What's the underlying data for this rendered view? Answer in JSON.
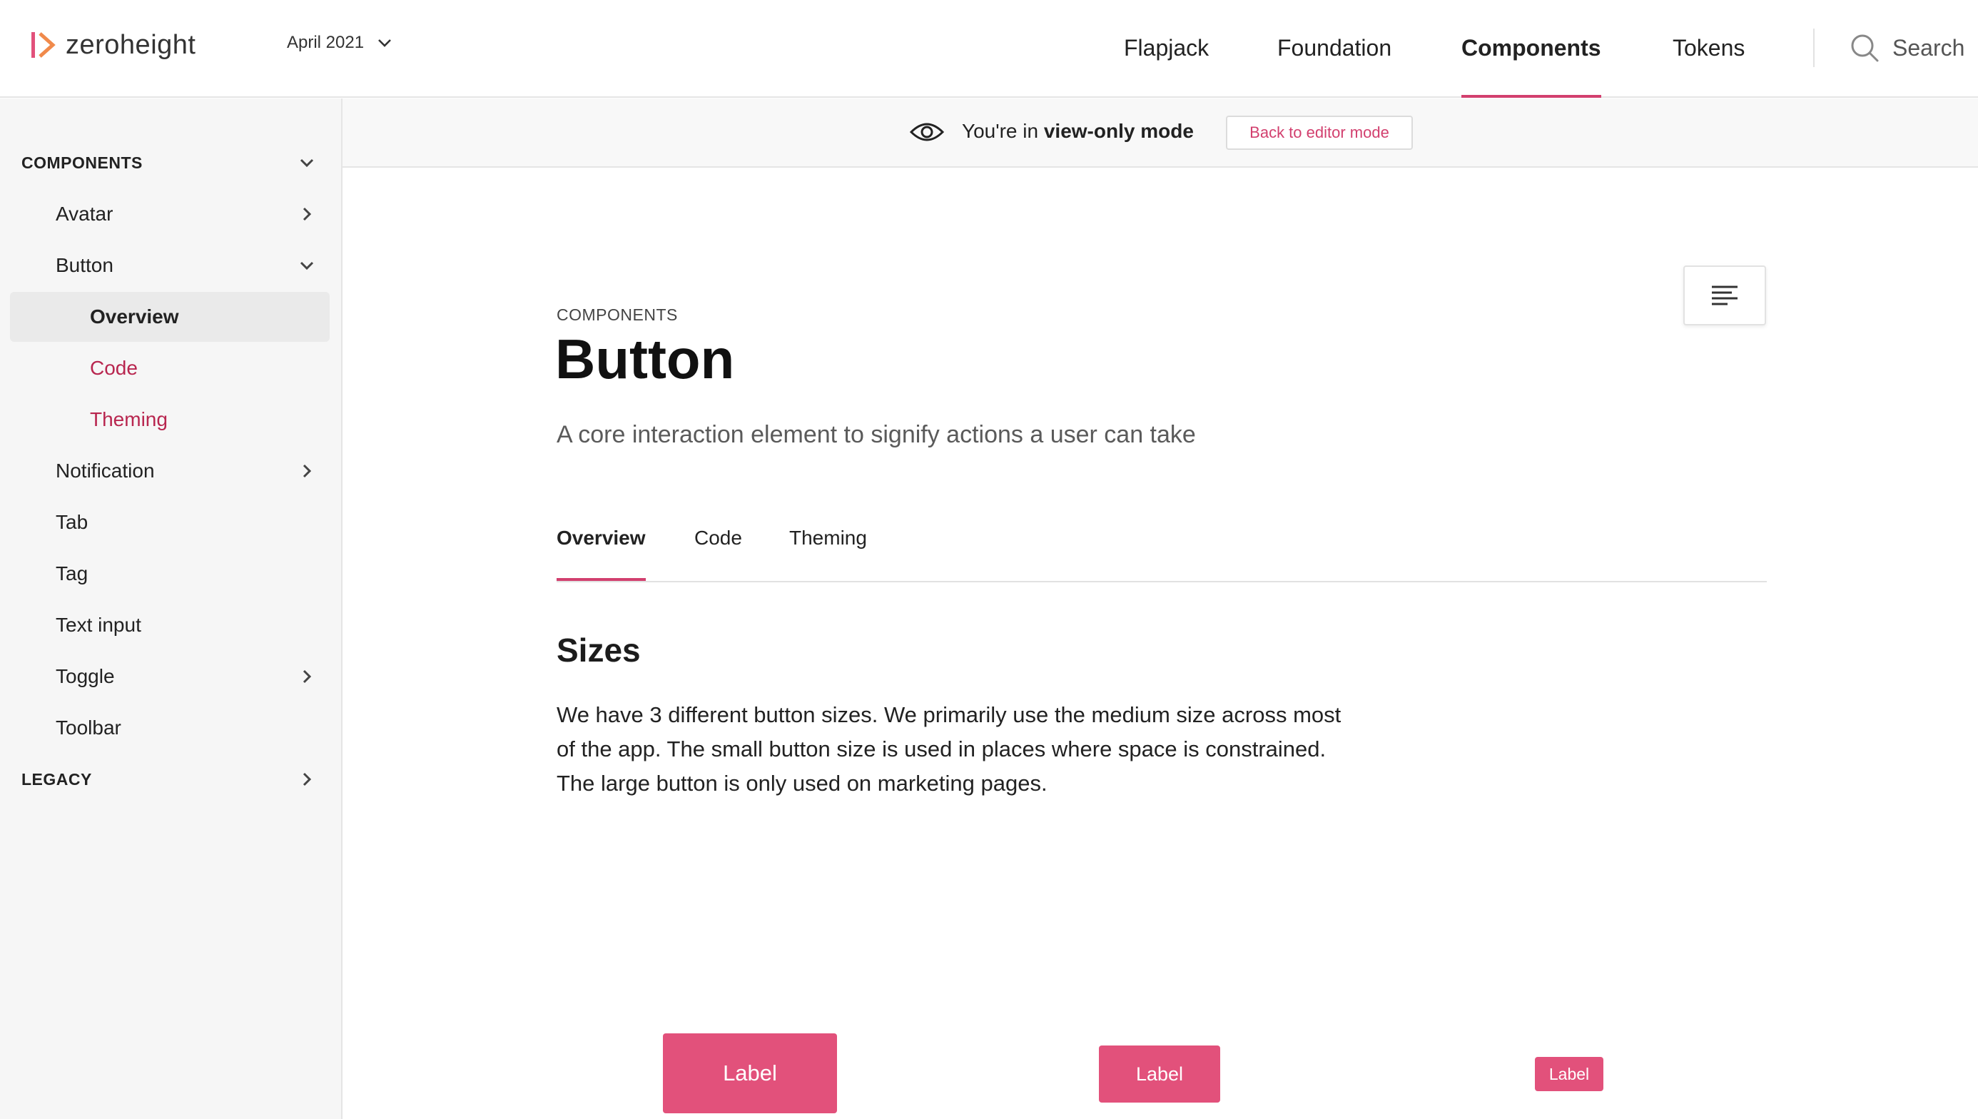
{
  "header": {
    "brand_name": "zeroheight",
    "version": "April 2021",
    "nav": [
      {
        "label": "Flapjack"
      },
      {
        "label": "Foundation"
      },
      {
        "label": "Components"
      },
      {
        "label": "Tokens"
      }
    ],
    "active_nav": "Components",
    "search_label": "Search"
  },
  "sidebar": {
    "items": [
      {
        "label": "COMPONENTS",
        "level": "section",
        "chevron": "chevron-down-icon"
      },
      {
        "label": "Avatar",
        "level": 1,
        "chevron": "chevron-right-icon"
      },
      {
        "label": "Button",
        "level": 1,
        "chevron": "chevron-down-icon"
      },
      {
        "label": "Overview",
        "level": 2,
        "selected": true
      },
      {
        "label": "Code",
        "level": 2
      },
      {
        "label": "Theming",
        "level": 2
      },
      {
        "label": "Notification",
        "level": 1,
        "chevron": "chevron-right-icon"
      },
      {
        "label": "Tab",
        "level": 1
      },
      {
        "label": "Tag",
        "level": 1
      },
      {
        "label": "Text input",
        "level": 1
      },
      {
        "label": "Toggle",
        "level": 1,
        "chevron": "chevron-right-icon"
      },
      {
        "label": "Toolbar",
        "level": 1
      },
      {
        "label": "LEGACY",
        "level": "section",
        "chevron": "chevron-right-icon"
      }
    ]
  },
  "banner": {
    "prefix": "You're in ",
    "mode": "view-only mode",
    "editor_button": "Back to editor mode"
  },
  "page": {
    "eyebrow": "COMPONENTS",
    "title": "Button",
    "subtitle": "A core interaction element to signify actions a user can take",
    "tabs": [
      {
        "label": "Overview"
      },
      {
        "label": "Code"
      },
      {
        "label": "Theming"
      }
    ],
    "active_tab": "Overview",
    "section_heading": "Sizes",
    "paragraph": "We have 3 different button sizes. We primarily use the medium size across most of the app. The small button size is used in places where space is constrained. The large button is only used on marketing pages.",
    "examples": {
      "large_label": "Label",
      "medium_label": "Label",
      "small_label": "Label"
    }
  },
  "colors": {
    "accent": "#d23f6e",
    "button": "#e2517b",
    "sidebar_accent_text": "#b8264f",
    "sidebar_bg": "#f6f6f6"
  }
}
